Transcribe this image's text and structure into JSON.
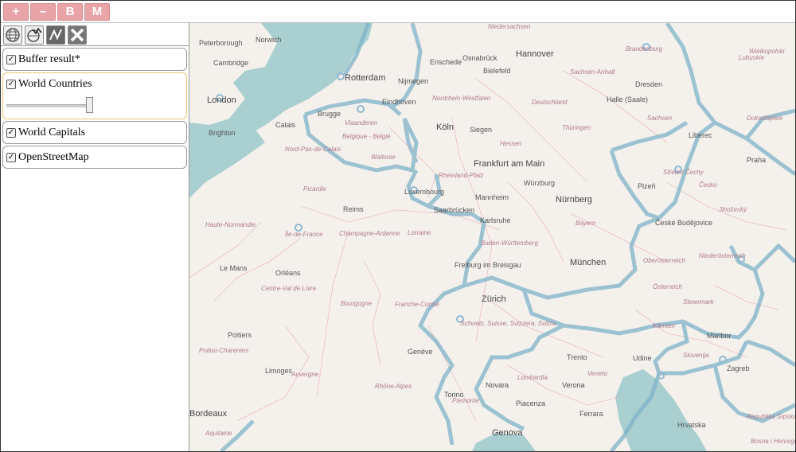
{
  "toolbar": {
    "zoom_in_label": "+",
    "zoom_out_label": "–",
    "b_label": "B",
    "m_label": "M"
  },
  "tools": [
    {
      "icon": "select-features-icon"
    },
    {
      "icon": "select-polygon-icon"
    },
    {
      "icon": "draw-line-icon"
    },
    {
      "icon": "clear-selection-icon"
    }
  ],
  "layers": [
    {
      "name": "Buffer result*",
      "checked": true
    },
    {
      "name": "World Countries",
      "checked": true,
      "opacity_percent": 100
    },
    {
      "name": "World Capitals",
      "checked": true
    },
    {
      "name": "OpenStreetMap",
      "checked": true
    }
  ],
  "map": {
    "cities": [
      "Peterborough",
      "Norwich",
      "Cambridge",
      "London",
      "Brighton",
      "Rotterdam",
      "Nijmegen",
      "Eindhoven",
      "Enschede",
      "Osnabrück",
      "Hannover",
      "Bielefeld",
      "Brugge",
      "Calais",
      "Köln",
      "Siegen",
      "Frankfurt am Main",
      "Würzburg",
      "Nürnberg",
      "Halle (Saale)",
      "Luxembourg",
      "Saarbrücken",
      "Karlsruhe",
      "Mannheim",
      "Reims",
      "Le Mans",
      "Orléans",
      "Freiburg im Breisgau",
      "Zürich",
      "München",
      "Poitiers",
      "Genève",
      "Trento",
      "Udine",
      "Novara",
      "Verona",
      "Torino",
      "Piacenza",
      "Ferrara",
      "Bordeaux",
      "Genova",
      "Plzeň",
      "České Budějovice",
      "Liberec",
      "Maribor",
      "Zagreb",
      "Hrvatska",
      "Limoges",
      "Praha",
      "Dresden"
    ],
    "regions": [
      "Niedersachsen",
      "Brandenburg",
      "Sachsen-Anhalt",
      "Deutschland",
      "Nordrhein-Westfalen",
      "Vlaanderen",
      "Belgique - België",
      "Wallonie",
      "Hessen",
      "Thüringen",
      "Nord-Pas-de-Calais",
      "Picardie",
      "Rheinland-Pfalz",
      "Bayern",
      "Baden-Württemberg",
      "Champagne-Ardenne",
      "Lorraine",
      "Haute-Normandie",
      "Île-de-France",
      "Centre-Val de Loire",
      "Bourgogne",
      "Franche-Comté",
      "Schweiz, Suisse, Svizzera, Svizra",
      "Oberösterreich",
      "Niederösterreich",
      "Österreich",
      "Steiermark",
      "Kärnten",
      "Slovenija",
      "Lombardia",
      "Veneto",
      "Piemonte",
      "Rhône-Alpes",
      "Auvergne",
      "Poitou-Charentes",
      "Aquitaine",
      "Střední Čechy",
      "Česko",
      "Jihočeský",
      "Sachsen",
      "Bosna i Hercegovina",
      "Republika Srpska",
      "Lubuskie",
      "Dolnośląskie",
      "Wielkopolski"
    ]
  }
}
